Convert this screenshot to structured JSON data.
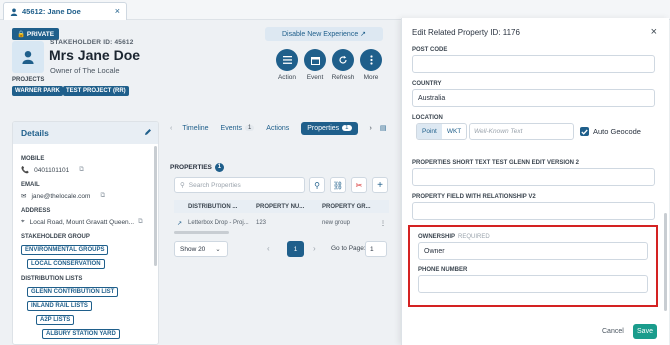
{
  "tab": {
    "title": "45612: Jane Doe",
    "close": "×"
  },
  "stakeholder": {
    "private_label": "PRIVATE",
    "id_label": "STAKEHOLDER ID: 45612",
    "name": "Mrs Jane Doe",
    "role": "Owner of The Locale",
    "projects_label": "PROJECTS",
    "projects": [
      "WARNER PARK",
      "TEST PROJECT (RR)"
    ]
  },
  "header": {
    "disable_label": "Disable New Experience",
    "actions": [
      "Action",
      "Event",
      "Refresh",
      "More"
    ]
  },
  "details": {
    "title": "Details",
    "mobile_label": "MOBILE",
    "mobile": "0401101101",
    "email_label": "EMAIL",
    "email": "jane@thelocale.com",
    "address_label": "ADDRESS",
    "address": "Local Road, Mount Gravatt Queen...",
    "group_label": "STAKEHOLDER GROUP",
    "groups": [
      "ENVIRONMENTAL GROUPS",
      "LOCAL CONSERVATION"
    ],
    "dist_label": "DISTRIBUTION LISTS",
    "dist": [
      "GLENN CONTRIBUTION LIST",
      "INLAND RAIL LISTS",
      "A2P LISTS",
      "ALBURY STATION YARD"
    ]
  },
  "content_tabs": {
    "timeline": "Timeline",
    "events": "Events",
    "events_count": "1",
    "actions": "Actions",
    "properties": "Properties",
    "properties_count": "1"
  },
  "properties": {
    "title": "PROPERTIES",
    "count": "1",
    "search_placeholder": "Search Properties",
    "columns": [
      "DISTRIBUTION ...",
      "PROPERTY NU...",
      "PROPERTY GR..."
    ],
    "row": [
      "Letterbox Drop - Proj...",
      "123",
      "new group"
    ],
    "show_label": "Show 20",
    "page": "1",
    "goto_label": "Go to Page:",
    "goto_value": "1"
  },
  "modal": {
    "title": "Edit Related Property ID: 1176",
    "close": "×",
    "postcode_label": "POST CODE",
    "postcode": "",
    "country_label": "COUNTRY",
    "country": "Australia",
    "location_label": "LOCATION",
    "point": "Point",
    "wkt": "WKT",
    "wkt_placeholder": "Well-Known Text",
    "geocode_label": "Auto Geocode",
    "short_text_label": "PROPERTIES SHORT TEXT TEST GLENN EDIT VERSION 2",
    "relationship_label": "PROPERTY FIELD WITH RELATIONSHIP V2",
    "ownership_label": "OWNERSHIP",
    "required": "REQUIRED",
    "ownership": "Owner",
    "phone_label": "PHONE NUMBER",
    "cancel": "Cancel",
    "save": "Save"
  },
  "colors": {
    "primary": "#1f5f8b",
    "save": "#1a9c8c",
    "highlight": "#d42222"
  }
}
